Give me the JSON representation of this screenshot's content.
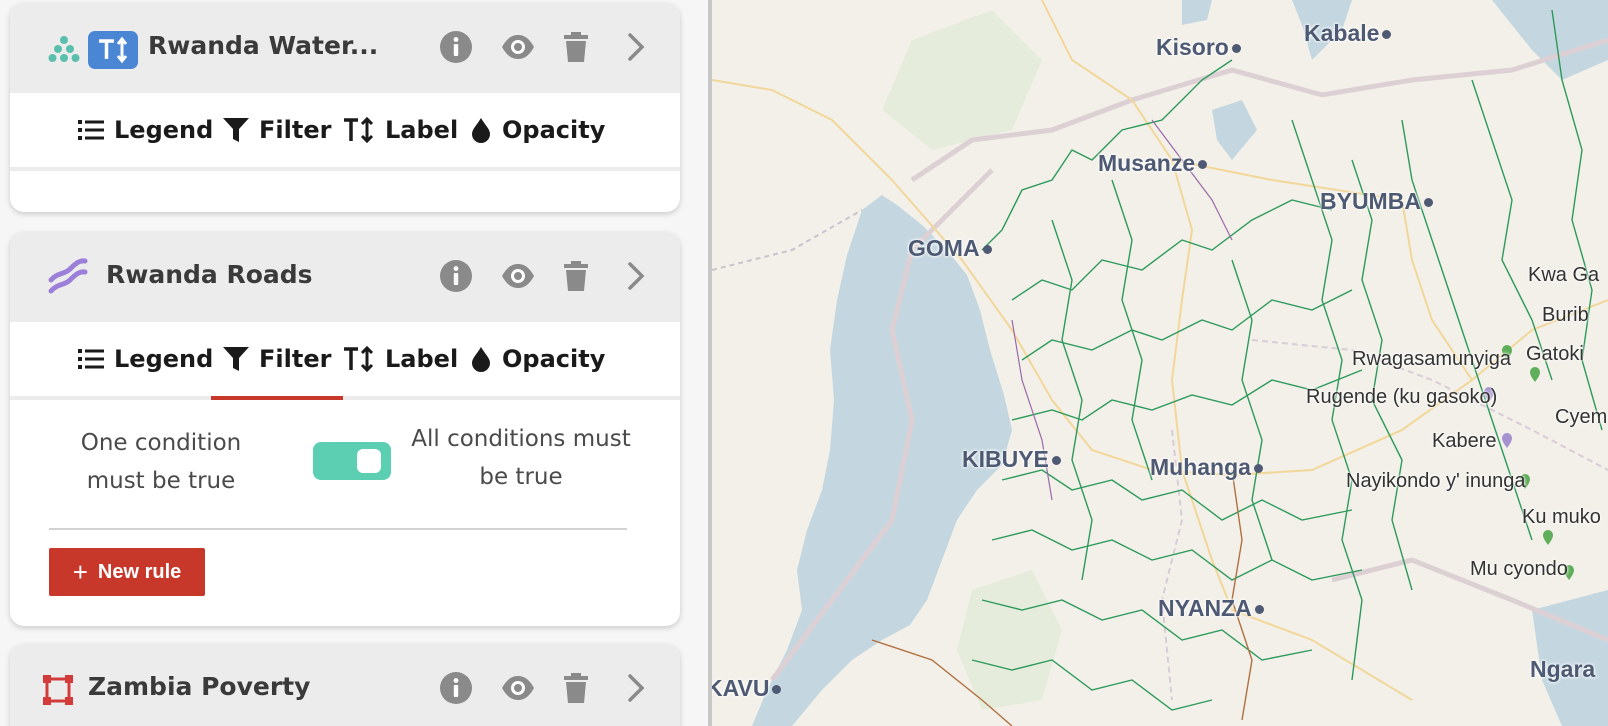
{
  "layers": [
    {
      "name": "Rwanda Water...",
      "tabs": [
        "Legend",
        "Filter",
        "Label",
        "Opacity"
      ],
      "active_tab": null
    },
    {
      "name": "Rwanda Roads",
      "tabs": [
        "Legend",
        "Filter",
        "Label",
        "Opacity"
      ],
      "active_tab": "Filter",
      "filter": {
        "left_option": "One condition must be true",
        "right_option": "All conditions must be true",
        "toggle_state": "all",
        "new_rule_label": "New rule"
      }
    },
    {
      "name": "Zambia Poverty"
    }
  ],
  "map": {
    "cities": [
      "Kisoro",
      "Kabale",
      "Musanze",
      "BYUMBA",
      "GOMA",
      "KIBUYE",
      "Muhanga",
      "NYANZA",
      "KAVU"
    ],
    "places": [
      "Kwa Ga",
      "Burib",
      "Rwagasamunyiga",
      "Gatoki",
      "Rugende (ku gasoko)",
      "Cyem",
      "Kabere",
      "Nayikondo y' inunga",
      "Ku muko",
      "Mu cyondo",
      "Ngara"
    ]
  },
  "colors": {
    "accent": "#c8382a",
    "toggle": "#5ccfb2",
    "water": "#c4d7e0",
    "rivers": "#2d9a5b",
    "city_label": "#4e5a73"
  }
}
